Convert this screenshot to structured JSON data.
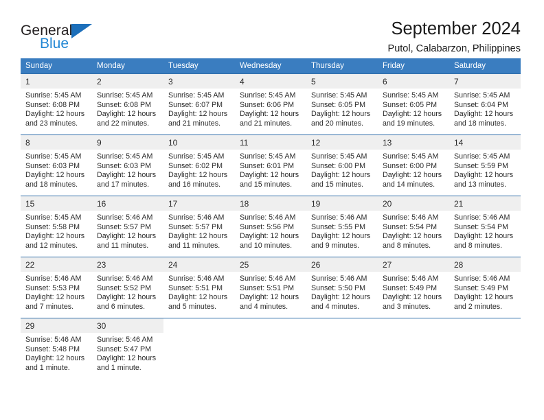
{
  "brand": {
    "name_part1": "General",
    "name_part2": "Blue",
    "triangle_icon": "triangle-icon"
  },
  "header": {
    "title": "September 2024",
    "subtitle": "Putol, Calabarzon, Philippines"
  },
  "colors": {
    "header_blue": "#3a7dc0",
    "row_border_blue": "#2d6ca8",
    "daynum_band": "#efefef",
    "brand_blue": "#2287d4",
    "brand_triangle": "#1c6fba"
  },
  "calendar": {
    "weekday_headers": [
      "Sunday",
      "Monday",
      "Tuesday",
      "Wednesday",
      "Thursday",
      "Friday",
      "Saturday"
    ],
    "labels": {
      "sunrise": "Sunrise:",
      "sunset": "Sunset:",
      "daylight": "Daylight:"
    },
    "weeks": [
      [
        {
          "day": "1",
          "sunrise": "Sunrise: 5:45 AM",
          "sunset": "Sunset: 6:08 PM",
          "daylight_line1": "Daylight: 12 hours",
          "daylight_line2": "and 23 minutes."
        },
        {
          "day": "2",
          "sunrise": "Sunrise: 5:45 AM",
          "sunset": "Sunset: 6:08 PM",
          "daylight_line1": "Daylight: 12 hours",
          "daylight_line2": "and 22 minutes."
        },
        {
          "day": "3",
          "sunrise": "Sunrise: 5:45 AM",
          "sunset": "Sunset: 6:07 PM",
          "daylight_line1": "Daylight: 12 hours",
          "daylight_line2": "and 21 minutes."
        },
        {
          "day": "4",
          "sunrise": "Sunrise: 5:45 AM",
          "sunset": "Sunset: 6:06 PM",
          "daylight_line1": "Daylight: 12 hours",
          "daylight_line2": "and 21 minutes."
        },
        {
          "day": "5",
          "sunrise": "Sunrise: 5:45 AM",
          "sunset": "Sunset: 6:05 PM",
          "daylight_line1": "Daylight: 12 hours",
          "daylight_line2": "and 20 minutes."
        },
        {
          "day": "6",
          "sunrise": "Sunrise: 5:45 AM",
          "sunset": "Sunset: 6:05 PM",
          "daylight_line1": "Daylight: 12 hours",
          "daylight_line2": "and 19 minutes."
        },
        {
          "day": "7",
          "sunrise": "Sunrise: 5:45 AM",
          "sunset": "Sunset: 6:04 PM",
          "daylight_line1": "Daylight: 12 hours",
          "daylight_line2": "and 18 minutes."
        }
      ],
      [
        {
          "day": "8",
          "sunrise": "Sunrise: 5:45 AM",
          "sunset": "Sunset: 6:03 PM",
          "daylight_line1": "Daylight: 12 hours",
          "daylight_line2": "and 18 minutes."
        },
        {
          "day": "9",
          "sunrise": "Sunrise: 5:45 AM",
          "sunset": "Sunset: 6:03 PM",
          "daylight_line1": "Daylight: 12 hours",
          "daylight_line2": "and 17 minutes."
        },
        {
          "day": "10",
          "sunrise": "Sunrise: 5:45 AM",
          "sunset": "Sunset: 6:02 PM",
          "daylight_line1": "Daylight: 12 hours",
          "daylight_line2": "and 16 minutes."
        },
        {
          "day": "11",
          "sunrise": "Sunrise: 5:45 AM",
          "sunset": "Sunset: 6:01 PM",
          "daylight_line1": "Daylight: 12 hours",
          "daylight_line2": "and 15 minutes."
        },
        {
          "day": "12",
          "sunrise": "Sunrise: 5:45 AM",
          "sunset": "Sunset: 6:00 PM",
          "daylight_line1": "Daylight: 12 hours",
          "daylight_line2": "and 15 minutes."
        },
        {
          "day": "13",
          "sunrise": "Sunrise: 5:45 AM",
          "sunset": "Sunset: 6:00 PM",
          "daylight_line1": "Daylight: 12 hours",
          "daylight_line2": "and 14 minutes."
        },
        {
          "day": "14",
          "sunrise": "Sunrise: 5:45 AM",
          "sunset": "Sunset: 5:59 PM",
          "daylight_line1": "Daylight: 12 hours",
          "daylight_line2": "and 13 minutes."
        }
      ],
      [
        {
          "day": "15",
          "sunrise": "Sunrise: 5:45 AM",
          "sunset": "Sunset: 5:58 PM",
          "daylight_line1": "Daylight: 12 hours",
          "daylight_line2": "and 12 minutes."
        },
        {
          "day": "16",
          "sunrise": "Sunrise: 5:46 AM",
          "sunset": "Sunset: 5:57 PM",
          "daylight_line1": "Daylight: 12 hours",
          "daylight_line2": "and 11 minutes."
        },
        {
          "day": "17",
          "sunrise": "Sunrise: 5:46 AM",
          "sunset": "Sunset: 5:57 PM",
          "daylight_line1": "Daylight: 12 hours",
          "daylight_line2": "and 11 minutes."
        },
        {
          "day": "18",
          "sunrise": "Sunrise: 5:46 AM",
          "sunset": "Sunset: 5:56 PM",
          "daylight_line1": "Daylight: 12 hours",
          "daylight_line2": "and 10 minutes."
        },
        {
          "day": "19",
          "sunrise": "Sunrise: 5:46 AM",
          "sunset": "Sunset: 5:55 PM",
          "daylight_line1": "Daylight: 12 hours",
          "daylight_line2": "and 9 minutes."
        },
        {
          "day": "20",
          "sunrise": "Sunrise: 5:46 AM",
          "sunset": "Sunset: 5:54 PM",
          "daylight_line1": "Daylight: 12 hours",
          "daylight_line2": "and 8 minutes."
        },
        {
          "day": "21",
          "sunrise": "Sunrise: 5:46 AM",
          "sunset": "Sunset: 5:54 PM",
          "daylight_line1": "Daylight: 12 hours",
          "daylight_line2": "and 8 minutes."
        }
      ],
      [
        {
          "day": "22",
          "sunrise": "Sunrise: 5:46 AM",
          "sunset": "Sunset: 5:53 PM",
          "daylight_line1": "Daylight: 12 hours",
          "daylight_line2": "and 7 minutes."
        },
        {
          "day": "23",
          "sunrise": "Sunrise: 5:46 AM",
          "sunset": "Sunset: 5:52 PM",
          "daylight_line1": "Daylight: 12 hours",
          "daylight_line2": "and 6 minutes."
        },
        {
          "day": "24",
          "sunrise": "Sunrise: 5:46 AM",
          "sunset": "Sunset: 5:51 PM",
          "daylight_line1": "Daylight: 12 hours",
          "daylight_line2": "and 5 minutes."
        },
        {
          "day": "25",
          "sunrise": "Sunrise: 5:46 AM",
          "sunset": "Sunset: 5:51 PM",
          "daylight_line1": "Daylight: 12 hours",
          "daylight_line2": "and 4 minutes."
        },
        {
          "day": "26",
          "sunrise": "Sunrise: 5:46 AM",
          "sunset": "Sunset: 5:50 PM",
          "daylight_line1": "Daylight: 12 hours",
          "daylight_line2": "and 4 minutes."
        },
        {
          "day": "27",
          "sunrise": "Sunrise: 5:46 AM",
          "sunset": "Sunset: 5:49 PM",
          "daylight_line1": "Daylight: 12 hours",
          "daylight_line2": "and 3 minutes."
        },
        {
          "day": "28",
          "sunrise": "Sunrise: 5:46 AM",
          "sunset": "Sunset: 5:49 PM",
          "daylight_line1": "Daylight: 12 hours",
          "daylight_line2": "and 2 minutes."
        }
      ],
      [
        {
          "day": "29",
          "sunrise": "Sunrise: 5:46 AM",
          "sunset": "Sunset: 5:48 PM",
          "daylight_line1": "Daylight: 12 hours",
          "daylight_line2": "and 1 minute."
        },
        {
          "day": "30",
          "sunrise": "Sunrise: 5:46 AM",
          "sunset": "Sunset: 5:47 PM",
          "daylight_line1": "Daylight: 12 hours",
          "daylight_line2": "and 1 minute."
        },
        {
          "day": "",
          "sunrise": "",
          "sunset": "",
          "daylight_line1": "",
          "daylight_line2": ""
        },
        {
          "day": "",
          "sunrise": "",
          "sunset": "",
          "daylight_line1": "",
          "daylight_line2": ""
        },
        {
          "day": "",
          "sunrise": "",
          "sunset": "",
          "daylight_line1": "",
          "daylight_line2": ""
        },
        {
          "day": "",
          "sunrise": "",
          "sunset": "",
          "daylight_line1": "",
          "daylight_line2": ""
        },
        {
          "day": "",
          "sunrise": "",
          "sunset": "",
          "daylight_line1": "",
          "daylight_line2": ""
        }
      ]
    ]
  }
}
